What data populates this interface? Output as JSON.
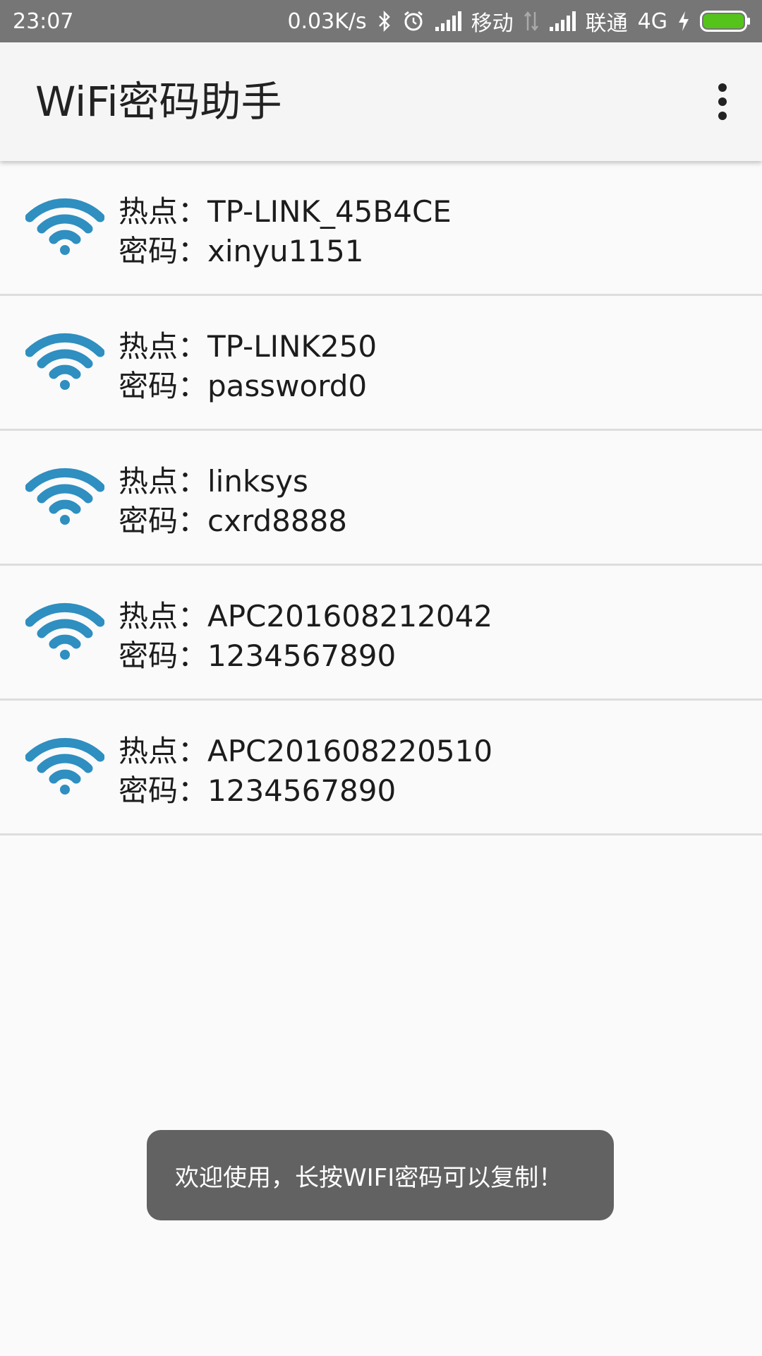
{
  "status_bar": {
    "time": "23:07",
    "net_speed": "0.03K/s",
    "carrier1": "移动",
    "carrier2": "联通",
    "network_type": "4G",
    "icons": [
      "bluetooth-icon",
      "alarm-icon",
      "signal-icon",
      "data-arrows-icon",
      "signal-icon",
      "charging-icon",
      "battery-icon"
    ],
    "battery_color": "#55c41a"
  },
  "app_bar": {
    "title": "WiFi密码助手",
    "menu_icon": "more-vert-icon"
  },
  "list": {
    "icon_color": "#2e8fc0",
    "hotspot_label": "热点：",
    "password_label": "密码：",
    "items": [
      {
        "ssid": "TP-LINK_45B4CE",
        "password": "xinyu1151"
      },
      {
        "ssid": "TP-LINK250",
        "password": "password0"
      },
      {
        "ssid": "linksys",
        "password": "cxrd8888"
      },
      {
        "ssid": "APC201608212042",
        "password": "1234567890"
      },
      {
        "ssid": "APC201608220510",
        "password": "1234567890"
      }
    ]
  },
  "toast": {
    "message": "欢迎使用，长按WIFI密码可以复制！"
  }
}
